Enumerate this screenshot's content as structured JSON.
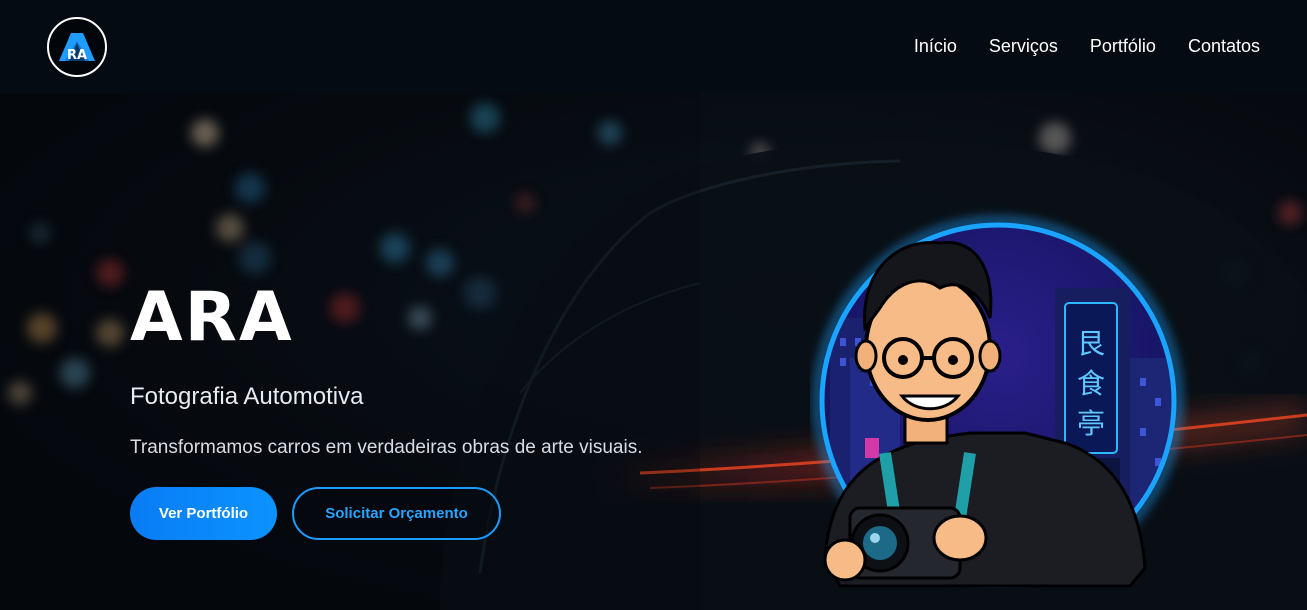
{
  "header": {
    "logo_text": "RA",
    "nav": [
      "Início",
      "Serviços",
      "Portfólio",
      "Contatos"
    ]
  },
  "hero": {
    "brand": "ARA",
    "subtitle": "Fotografia Automotiva",
    "tagline": "Transformamos carros em verdadeiras obras de arte visuais.",
    "primary_button": "Ver Portfólio",
    "secondary_button": "Solicitar Orçamento",
    "neon_sign": [
      "艮",
      "食",
      "亭"
    ]
  },
  "icons": {
    "logo": "ara-logo-icon",
    "avatar": "photographer-avatar-illustration"
  },
  "colors": {
    "accent": "#0b93ff",
    "header_bg": "#050b12",
    "hero_bg": "#070b11",
    "ring": "#1aa3ff"
  }
}
